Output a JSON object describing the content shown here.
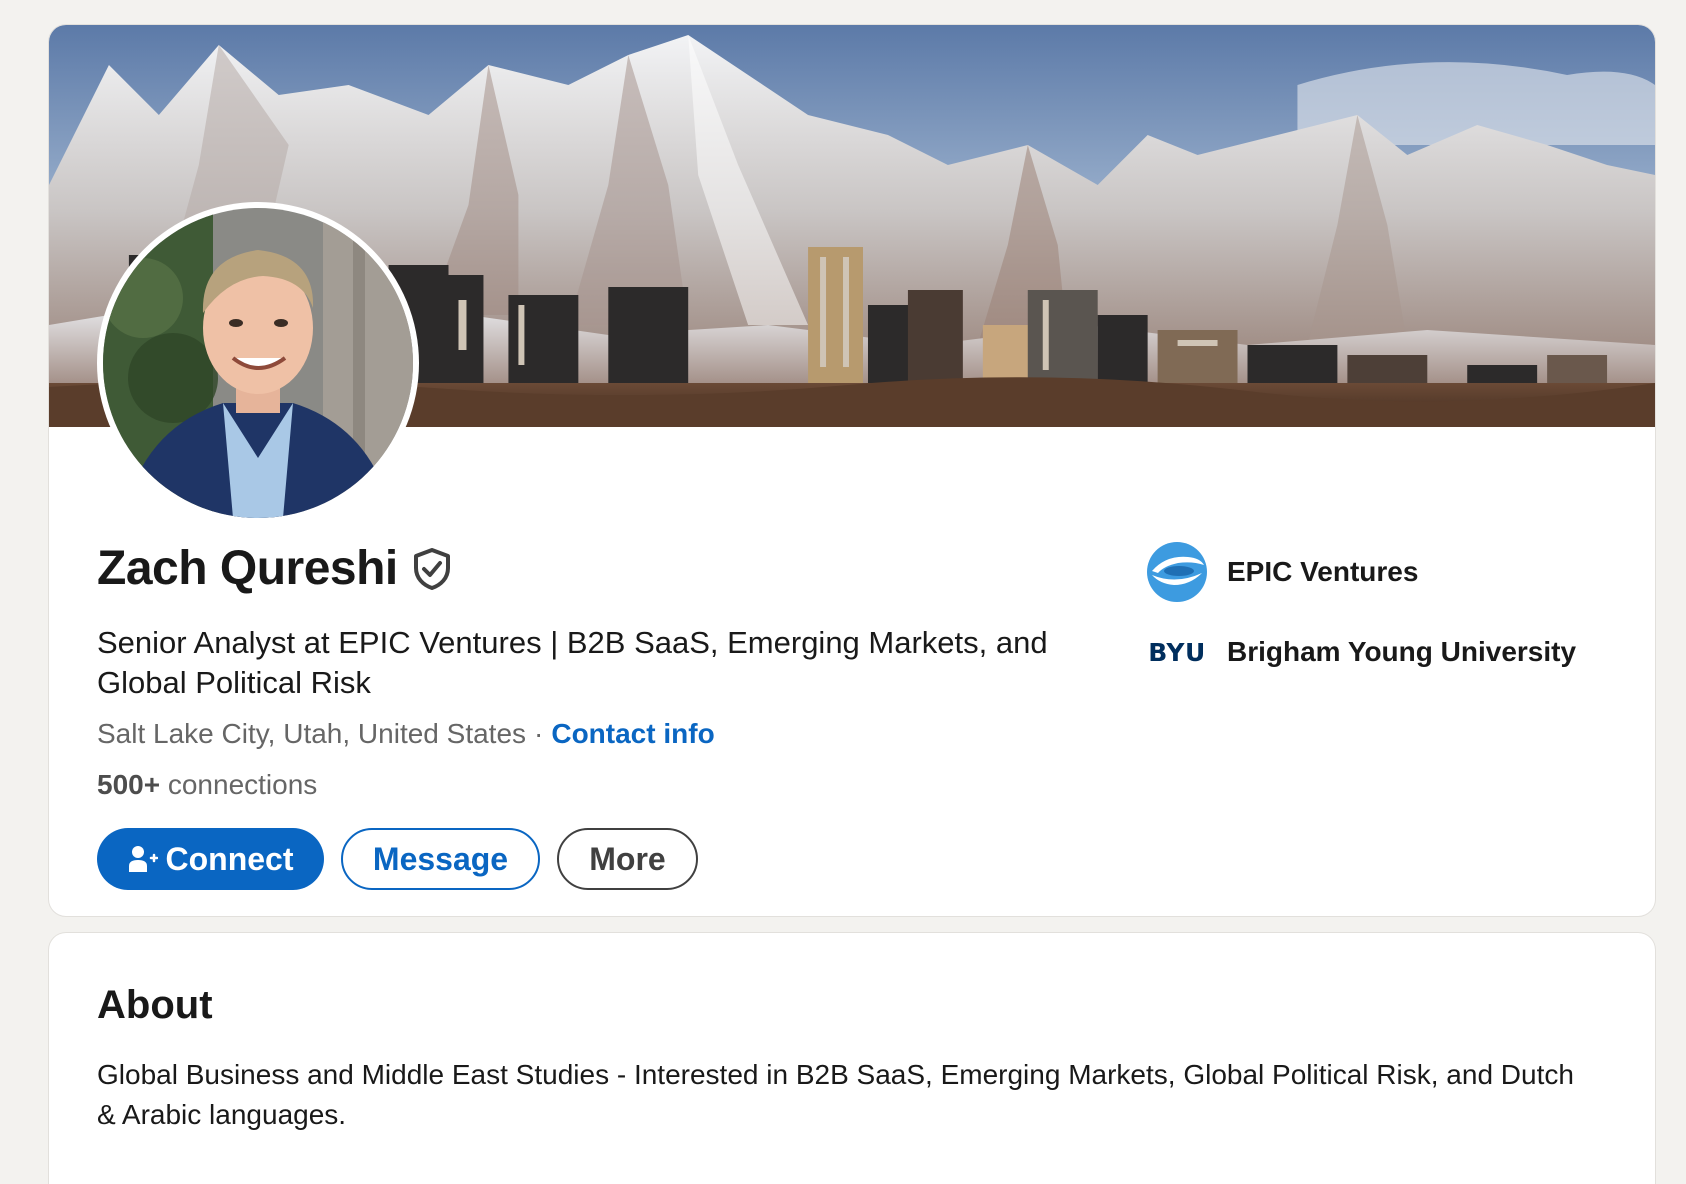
{
  "profile": {
    "name": "Zach Qureshi",
    "headline": "Senior Analyst at EPIC Ventures | B2B SaaS, Emerging Markets, and Global Political Risk",
    "location": "Salt Lake City, Utah, United States",
    "separator": "·",
    "contact_info_label": "Contact info",
    "connections_count": "500+",
    "connections_label": "connections",
    "verified_icon": "shield-check-icon",
    "banner_description": "snowy mountains over city skyline"
  },
  "actions": {
    "connect_label": "Connect",
    "connect_icon": "add-person-icon",
    "message_label": "Message",
    "more_label": "More"
  },
  "organizations": [
    {
      "name": "EPIC Ventures",
      "logo": "epic-ventures-logo"
    },
    {
      "name": "Brigham Young University",
      "logo_text": "BYU"
    }
  ],
  "about": {
    "title": "About",
    "text": "Global Business and Middle East Studies - Interested in B2B SaaS, Emerging Markets, Global Political Risk, and Dutch & Arabic languages."
  },
  "colors": {
    "primary": "#0a66c2",
    "page_background": "#f3f2ef",
    "card_background": "#ffffff",
    "text": "#191919",
    "muted_text": "#666666",
    "byu_navy": "#002e5d"
  }
}
